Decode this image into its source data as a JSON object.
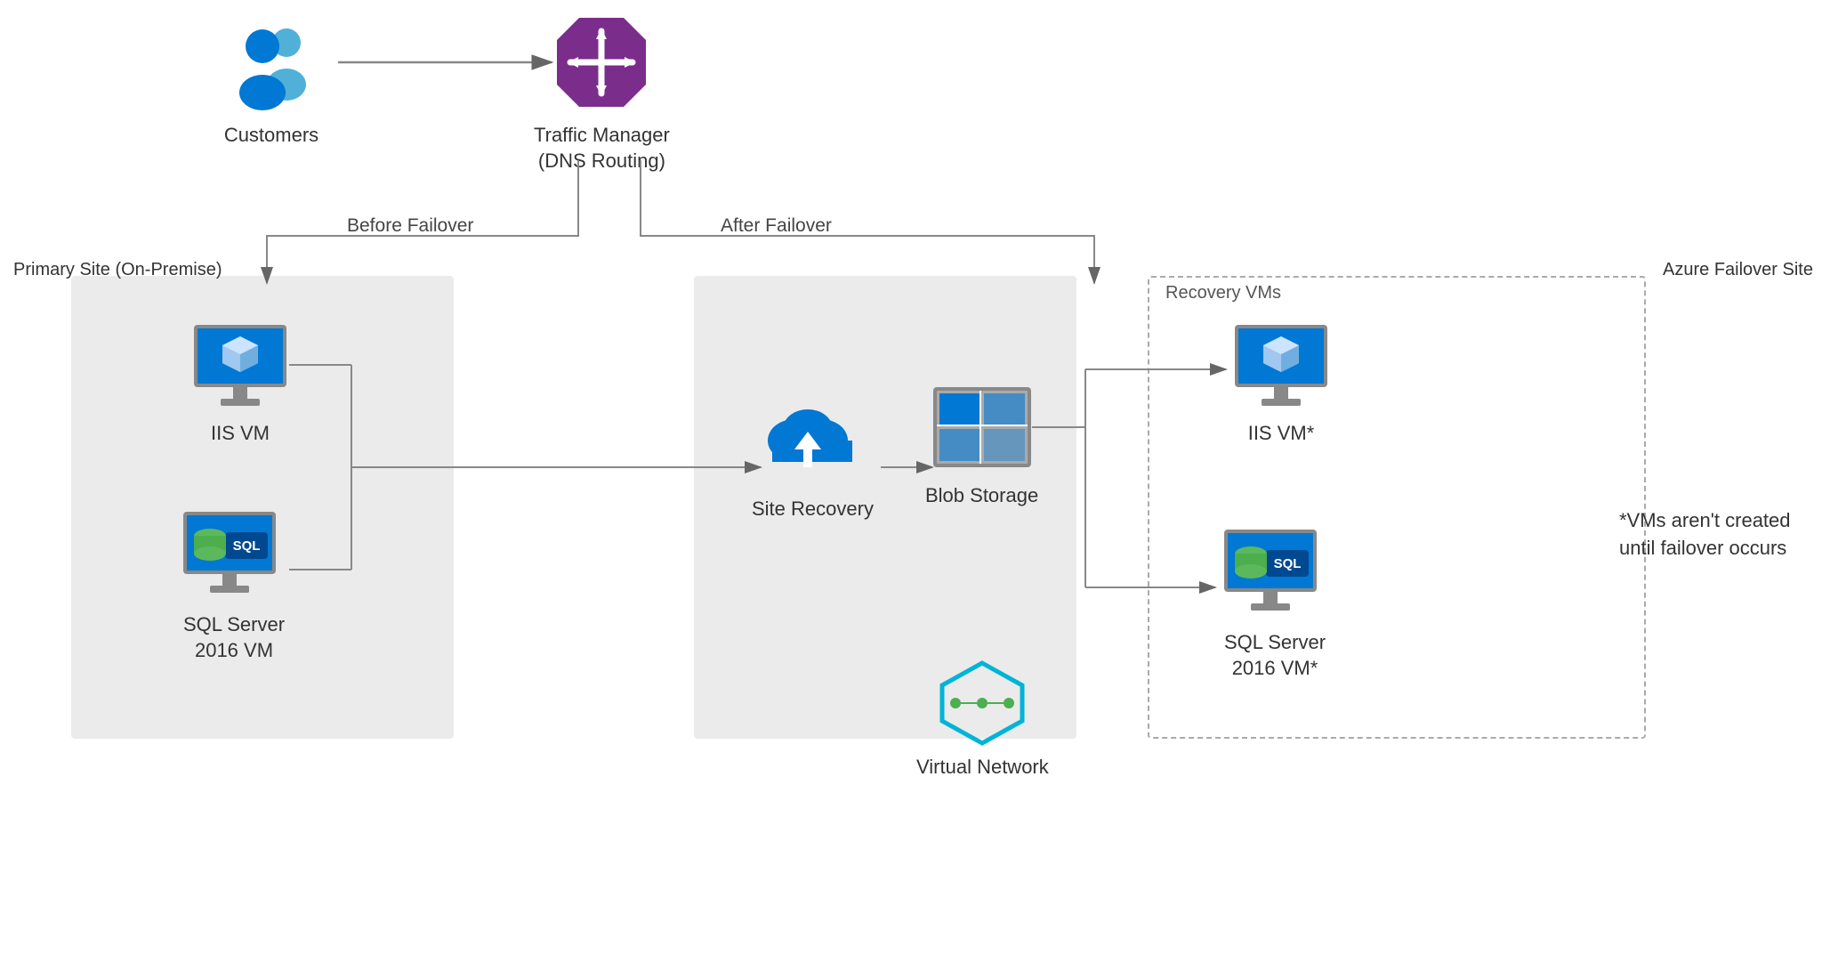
{
  "labels": {
    "customers": "Customers",
    "traffic_manager": "Traffic Manager\n(DNS Routing)",
    "traffic_manager_line1": "Traffic Manager",
    "traffic_manager_line2": "(DNS Routing)",
    "primary_site": "Primary Site (On-Premise)",
    "azure_site": "Azure Failover Site",
    "recovery_vms": "Recovery VMs",
    "iis_vm": "IIS VM",
    "iis_vm_star": "IIS VM*",
    "sql_vm": "SQL Server\n2016 VM",
    "sql_vm_line1": "SQL Server",
    "sql_vm_line2": "2016 VM",
    "sql_vm_star_line1": "SQL Server",
    "sql_vm_star_line2": "2016 VM*",
    "site_recovery": "Site Recovery",
    "blob_storage": "Blob Storage",
    "virtual_network": "Virtual Network",
    "before_failover": "Before Failover",
    "after_failover": "After Failover",
    "vms_note": "*VMs aren't created until failover occurs"
  },
  "colors": {
    "blue": "#0078d4",
    "light_blue": "#50b0d8",
    "purple": "#7b2d8b",
    "gray": "#999999",
    "dark_gray": "#555555",
    "green": "#4caf50",
    "teal": "#00b4d8",
    "sql_blue": "#004990"
  }
}
